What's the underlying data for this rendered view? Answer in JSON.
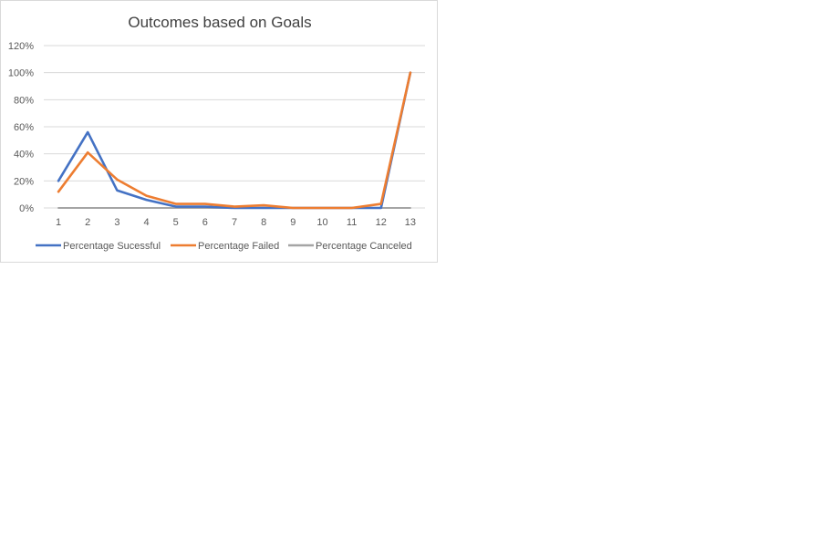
{
  "chart_data": {
    "type": "line",
    "title": "Outcomes based on Goals",
    "xlabel": "",
    "ylabel": "",
    "categories": [
      "1",
      "2",
      "3",
      "4",
      "5",
      "6",
      "7",
      "8",
      "9",
      "10",
      "11",
      "12",
      "13"
    ],
    "ylim": [
      0,
      1.2
    ],
    "yticks": [
      "0%",
      "20%",
      "40%",
      "60%",
      "80%",
      "100%",
      "120%"
    ],
    "grid": true,
    "legend_position": "bottom",
    "series": [
      {
        "name": "Percentage Sucessful",
        "color": "#4472c4",
        "values": [
          0.2,
          0.56,
          0.13,
          0.06,
          0.01,
          0.01,
          0.0,
          0.0,
          0.0,
          0.0,
          0.0,
          0.0,
          1.0
        ]
      },
      {
        "name": "Percentage Failed",
        "color": "#ed7d31",
        "values": [
          0.12,
          0.41,
          0.21,
          0.09,
          0.03,
          0.03,
          0.01,
          0.02,
          0.0,
          0.0,
          0.0,
          0.03,
          1.0
        ]
      },
      {
        "name": "Percentage Canceled",
        "color": "#a5a5a5",
        "values": [
          0,
          0,
          0,
          0,
          0,
          0,
          0,
          0,
          0,
          0,
          0,
          0,
          0
        ]
      }
    ]
  }
}
